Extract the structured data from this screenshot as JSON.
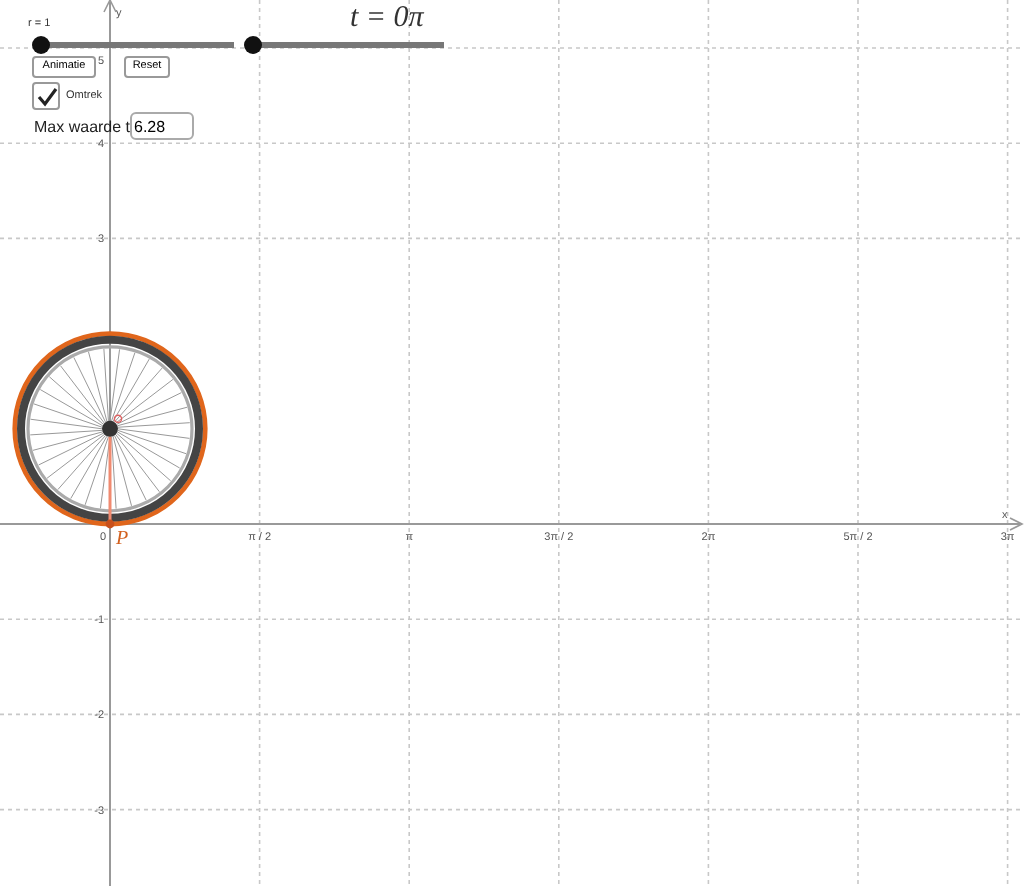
{
  "sliders": [
    {
      "label": "r = 1",
      "level": 0
    },
    {
      "level": 0
    }
  ],
  "formula": "t = 0π",
  "buttons": [
    "Animatie",
    "Reset"
  ],
  "checkbox": {
    "label": "Omtrek",
    "checked": true
  },
  "max_field": {
    "label": "Max waarde t",
    "value": "6.28"
  },
  "axes": {
    "x_label": "x",
    "y_label": "y",
    "x_ticks": [
      "0",
      "π / 2",
      "π",
      "3π / 2",
      "2π",
      "5π / 2",
      "3π"
    ],
    "y_ticks_positive": [
      "5",
      "4",
      "3"
    ],
    "y_ticks_negative": [
      "-1",
      "-2",
      "-3"
    ]
  },
  "point": {
    "label": "P"
  }
}
